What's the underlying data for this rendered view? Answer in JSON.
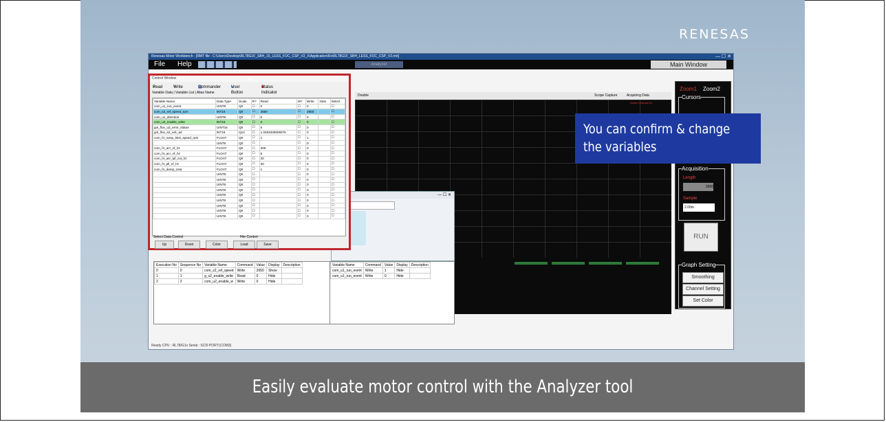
{
  "brand": "RENESAS",
  "caption": "Easily evaluate motor control with the Analyzer tool",
  "callout": {
    "line1": "You can confirm & change",
    "line2": "the variables"
  },
  "app": {
    "title": "Renesas Motor Workbench - [RMT file : C:\\Users\\Desktop\\RL78G1F_SBH_15_LESS_FOC_CSP_V2_X\\Application\\Rx\\RL78G1F_SBH_LESS_FOC_CSP_V2.rmt]",
    "menu": {
      "file": "File",
      "help": "Help"
    },
    "analyze_button": "Analyzer",
    "main_window_label": "Main Window",
    "status": "Ready  CPU : RL78/G1x Serial : SCI0  PORT:(COM3)"
  },
  "control_window": {
    "title": "Control Window",
    "toolbar": {
      "read": "Read",
      "write": "Write",
      "commander": "Commander",
      "user_button": "User Button",
      "status_indicator": "Status Indicator"
    },
    "tabs": [
      "Variable Data",
      "Variable List",
      "Alias Name"
    ],
    "columns": [
      "Variable Name",
      "Data Type",
      "Scale",
      "R?",
      "Read",
      "W?",
      "Write",
      "Note",
      "Select"
    ],
    "rows": [
      {
        "name": "com_u1_run_event",
        "type": "UINT8",
        "scale": "Q0",
        "read": "0",
        "write": "0",
        "hl": ""
      },
      {
        "name": "com_s2_ref_speed_rpm",
        "type": "INT16",
        "scale": "Q0",
        "read": "2650",
        "write": "2650",
        "hl": "blue"
      },
      {
        "name": "com_u1_direction",
        "type": "UINT8",
        "scale": "Q0",
        "read": "0",
        "write": "0",
        "hl": ""
      },
      {
        "name": "com_u2_enable_write",
        "type": "INT16",
        "scale": "Q0",
        "read": "0",
        "write": "0",
        "hl": "green"
      },
      {
        "name": "gol_flox_u2_error_status",
        "type": "UINT16",
        "scale": "Q0",
        "read": "0",
        "write": "0",
        "hl": ""
      },
      {
        "name": "gol_flox_s2_vdc_ad",
        "type": "INT16",
        "scale": "Q12",
        "read": "1.0453349609375",
        "write": "0",
        "hl": ""
      },
      {
        "name": "com_f4_ramp_limit_speed_rpm",
        "type": "FLOAT",
        "scale": "Q0",
        "read": "1",
        "write": "1",
        "hl": ""
      },
      {
        "name": "",
        "type": "UINT8",
        "scale": "Q0",
        "read": "",
        "write": "0",
        "hl": ""
      },
      {
        "name": "com_f4_acr_nf_hz",
        "type": "FLOAT",
        "scale": "Q0",
        "read": "300",
        "write": "0",
        "hl": ""
      },
      {
        "name": "com_f4_acr_nf_hz",
        "type": "FLOAT",
        "scale": "Q0",
        "read": "5",
        "write": "0",
        "hl": ""
      },
      {
        "name": "com_f4_asr_lpf_cut_hz",
        "type": "FLOAT",
        "scale": "Q0",
        "read": "20",
        "write": "0",
        "hl": ""
      },
      {
        "name": "com_f4_pll_nf_hz",
        "type": "FLOAT",
        "scale": "Q0",
        "read": "30",
        "write": "0",
        "hl": ""
      },
      {
        "name": "com_f4_damp_zeta",
        "type": "FLOAT",
        "scale": "Q0",
        "read": "1",
        "write": "0",
        "hl": ""
      },
      {
        "name": "",
        "type": "UINT8",
        "scale": "Q0",
        "read": "",
        "write": "0",
        "hl": ""
      },
      {
        "name": "",
        "type": "UINT8",
        "scale": "Q0",
        "read": "",
        "write": "0",
        "hl": ""
      },
      {
        "name": "",
        "type": "UINT8",
        "scale": "Q0",
        "read": "",
        "write": "0",
        "hl": ""
      },
      {
        "name": "",
        "type": "UINT8",
        "scale": "Q0",
        "read": "",
        "write": "0",
        "hl": ""
      },
      {
        "name": "",
        "type": "UINT8",
        "scale": "Q0",
        "read": "",
        "write": "0",
        "hl": ""
      },
      {
        "name": "",
        "type": "UINT8",
        "scale": "Q0",
        "read": "",
        "write": "0",
        "hl": ""
      },
      {
        "name": "",
        "type": "UINT8",
        "scale": "Q0",
        "read": "",
        "write": "0",
        "hl": ""
      },
      {
        "name": "",
        "type": "UINT8",
        "scale": "Q0",
        "read": "",
        "write": "0",
        "hl": ""
      },
      {
        "name": "",
        "type": "UINT8",
        "scale": "Q0",
        "read": "",
        "write": "0",
        "hl": ""
      }
    ],
    "select_data_control": "Select Data Control",
    "file_control": "File Control",
    "buttons": {
      "up": "Up",
      "down": "Down",
      "color": "Color",
      "load": "Load",
      "save": "Save"
    }
  },
  "scope": {
    "double_label": "Double",
    "scope_capture": "Scope Capture",
    "acquiring": "Acquiring Data",
    "active_channel": "Active Channel #1"
  },
  "right_panel": {
    "zoom1": "Zoom1",
    "zoom2": "Zoom2",
    "cursors": "Cursors",
    "acquisition": "Acquisition",
    "length": "Length",
    "length_value": "2000",
    "sample": "Sample",
    "sample_value": "2.00m",
    "run": "RUN",
    "graph_setting": "Graph Setting",
    "smoothing": "Smoothing",
    "channel_setting": "Channel Setting",
    "set_color": "Set Color"
  },
  "sequence_panel": {
    "columns": [
      "Execution No",
      "Sequence No",
      "Variable Name",
      "Command",
      "Value",
      "Display",
      "Description"
    ],
    "rows": [
      [
        "0",
        "0",
        "com_s2_ref_speed",
        "Write",
        "2650",
        "Show",
        ""
      ],
      [
        "1",
        "1",
        "g_s2_enable_write",
        "Read",
        "0",
        "Hide",
        ""
      ],
      [
        "2",
        "2",
        "com_u2_enable_w",
        "Write",
        "0",
        "Hide",
        ""
      ]
    ]
  },
  "var_panel2": {
    "columns": [
      "Variable Name",
      "Command",
      "Value",
      "Display",
      "Description"
    ],
    "rows": [
      [
        "com_u1_run_event",
        "Write",
        "1",
        "Hide",
        ""
      ],
      [
        "com_u1_run_event",
        "Write",
        "0",
        "Hide",
        ""
      ]
    ]
  },
  "colors": {
    "brand_blue": "#1e3aa0",
    "highlight_border": "#c0262c",
    "menubar": "#0a0a0a"
  }
}
